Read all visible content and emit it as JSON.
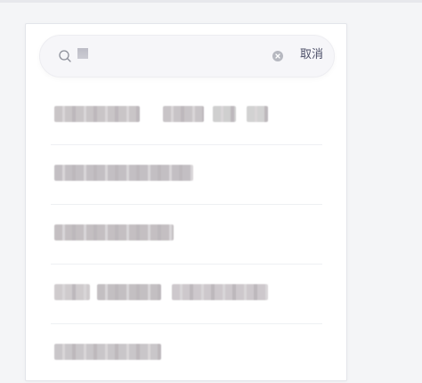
{
  "search": {
    "cancel_label": "取消"
  },
  "suggestions": [
    {
      "segments": [
        {
          "offset": 18,
          "width": 96,
          "color": "#c9c5c7"
        },
        {
          "offset": 140,
          "width": 46,
          "color": "#c8c4c7"
        },
        {
          "offset": 196,
          "width": 26,
          "color": "#cfcfcf"
        },
        {
          "offset": 234,
          "width": 24,
          "color": "#d2d2d2"
        }
      ]
    },
    {
      "segments": [
        {
          "offset": 4,
          "width": 156,
          "color": "#c3bfc3"
        }
      ]
    },
    {
      "segments": [
        {
          "offset": 4,
          "width": 134,
          "color": "#c4bfc2"
        }
      ]
    },
    {
      "segments": [
        {
          "offset": 4,
          "width": 40,
          "color": "#cfcbcd"
        },
        {
          "offset": 52,
          "width": 72,
          "color": "#c3bfc2"
        },
        {
          "offset": 136,
          "width": 108,
          "color": "#cdc8cc"
        }
      ]
    },
    {
      "segments": [
        {
          "offset": 4,
          "width": 120,
          "color": "#c9c6c9"
        }
      ]
    }
  ]
}
